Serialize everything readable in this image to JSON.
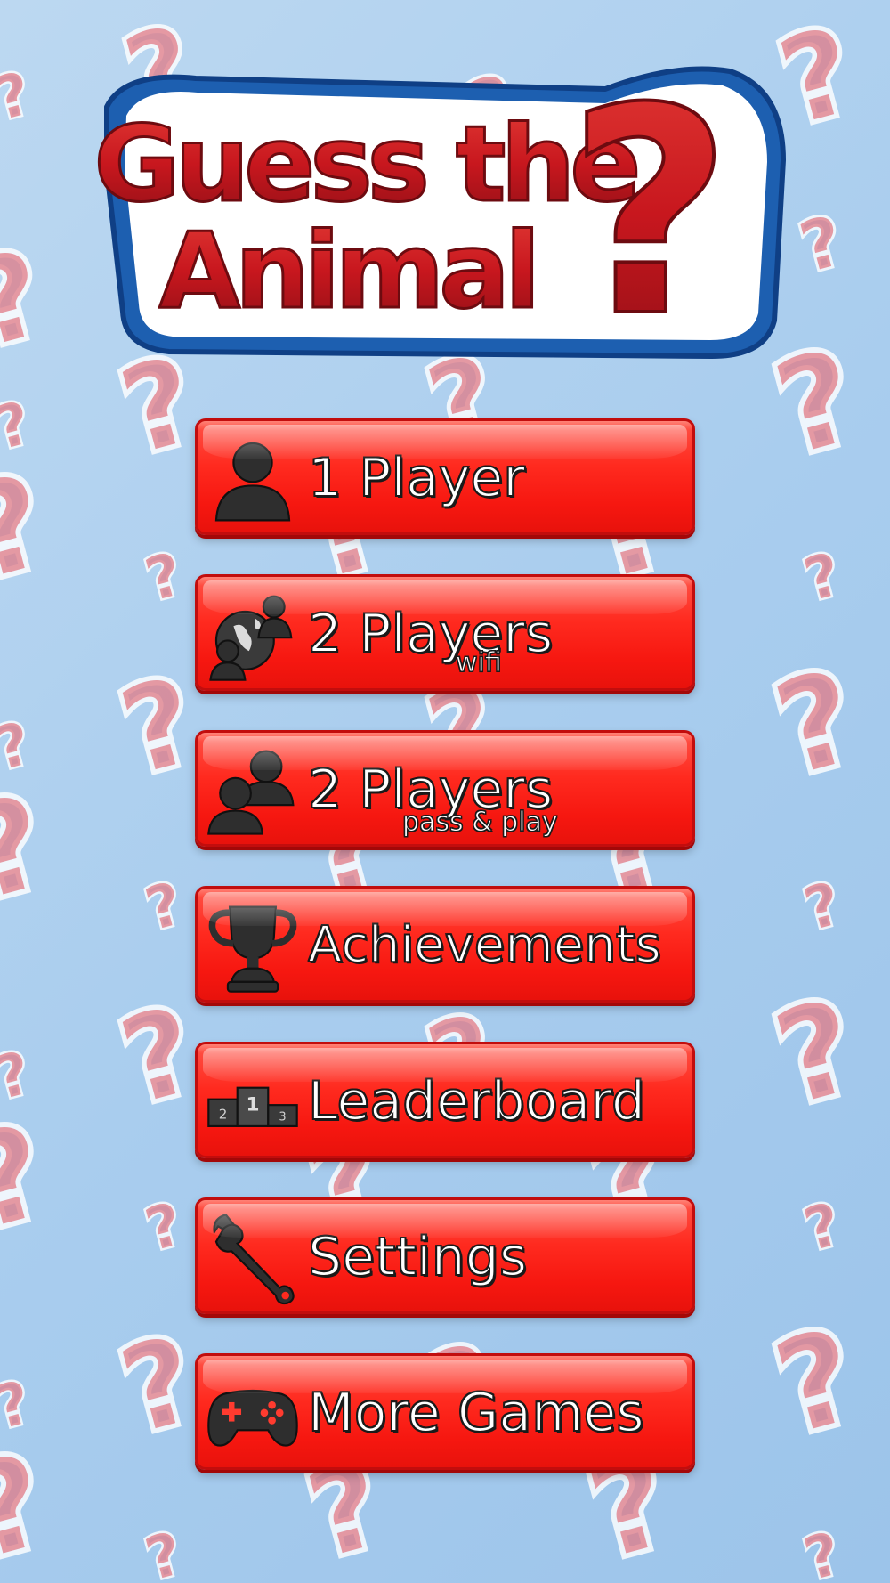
{
  "title": {
    "line1": "Guess the",
    "line2": "Animal",
    "mark": "?"
  },
  "menu": [
    {
      "label": "1 Player",
      "sub": "",
      "icon": "person-icon"
    },
    {
      "label": "2 Players",
      "sub": "wifi",
      "icon": "online-players-icon"
    },
    {
      "label": "2 Players",
      "sub": "pass & play",
      "icon": "two-players-icon"
    },
    {
      "label": "Achievements",
      "sub": "",
      "icon": "trophy-icon"
    },
    {
      "label": "Leaderboard",
      "sub": "",
      "icon": "podium-icon"
    },
    {
      "label": "Settings",
      "sub": "",
      "icon": "wrench-icon"
    },
    {
      "label": "More Games",
      "sub": "",
      "icon": "gamepad-icon"
    }
  ],
  "podium_numbers": [
    "2",
    "1",
    "3"
  ],
  "colors": {
    "button": "#ff2a1f",
    "title_red": "#c0181f",
    "title_blue": "#1d5fb0",
    "background": "#aacdee"
  }
}
